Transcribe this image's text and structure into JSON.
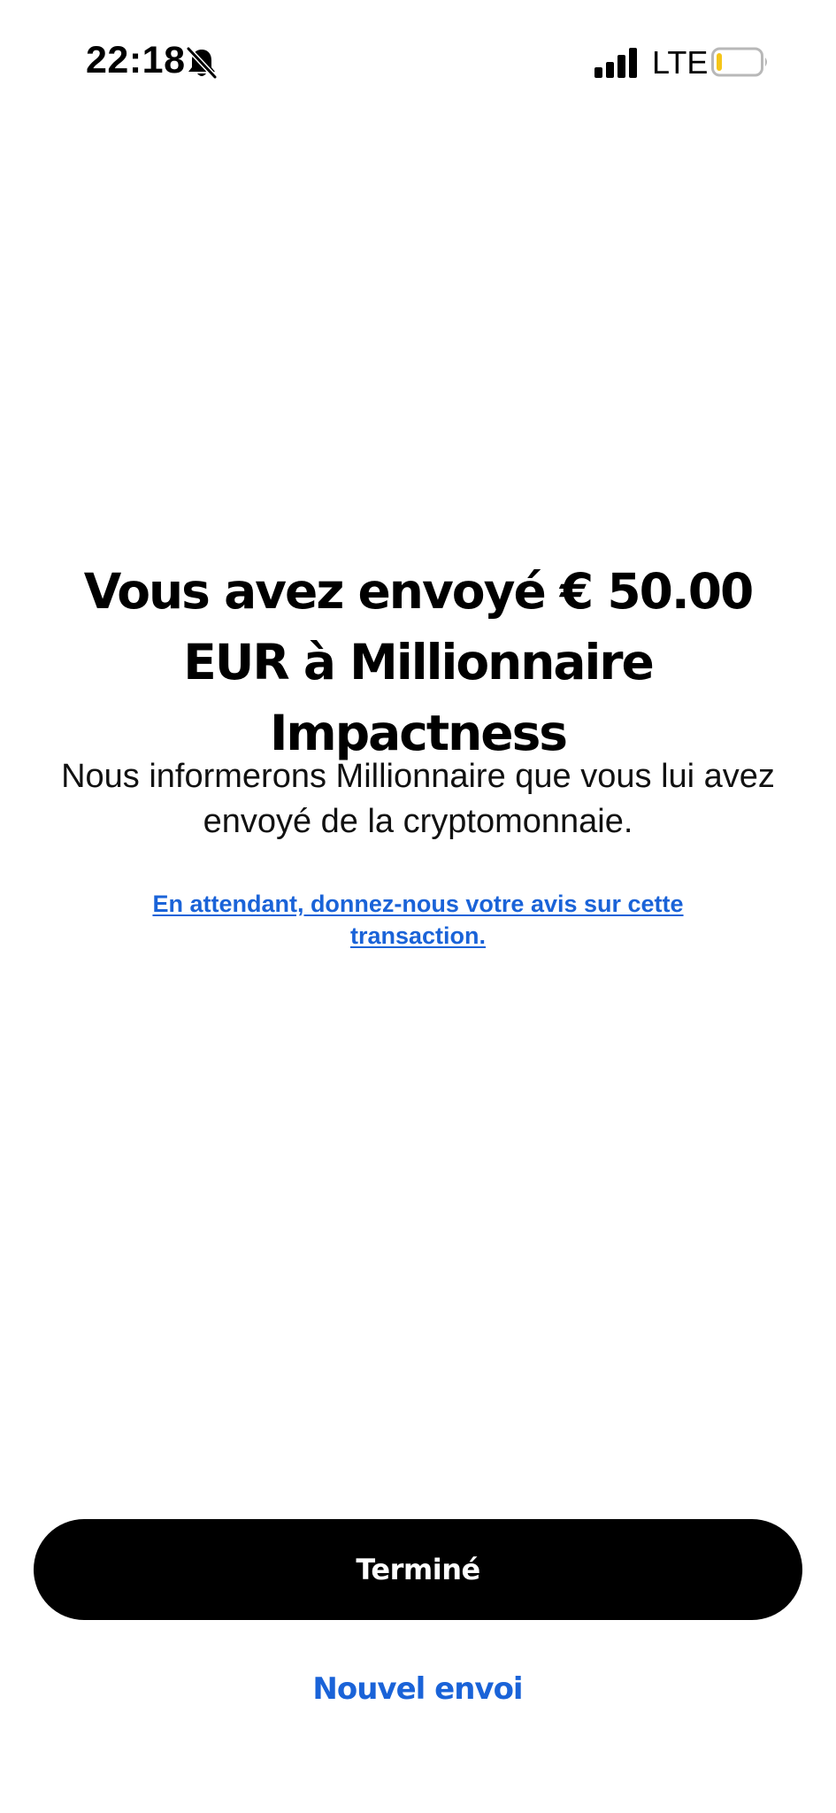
{
  "status_bar": {
    "time": "22:18",
    "network": "LTE",
    "icons": {
      "silent": "bell-slash-icon",
      "signal": "cellular-signal-icon",
      "battery": "battery-low-icon"
    },
    "battery_level": 0.12,
    "battery_color": "#f5c518"
  },
  "confirmation": {
    "headline": "Vous avez envoyé € 50.00 EUR à Millionnaire Impactness",
    "subtitle": "Nous informerons Millionnaire que vous lui avez envoyé de la cryptomonnaie.",
    "feedback_link": "En attendant, donnez-nous votre avis sur cette transaction."
  },
  "actions": {
    "done_label": "Terminé",
    "new_send_label": "Nouvel envoi"
  },
  "colors": {
    "accent": "#1a63d8",
    "primary_button": "#000000",
    "background": "#ffffff"
  }
}
